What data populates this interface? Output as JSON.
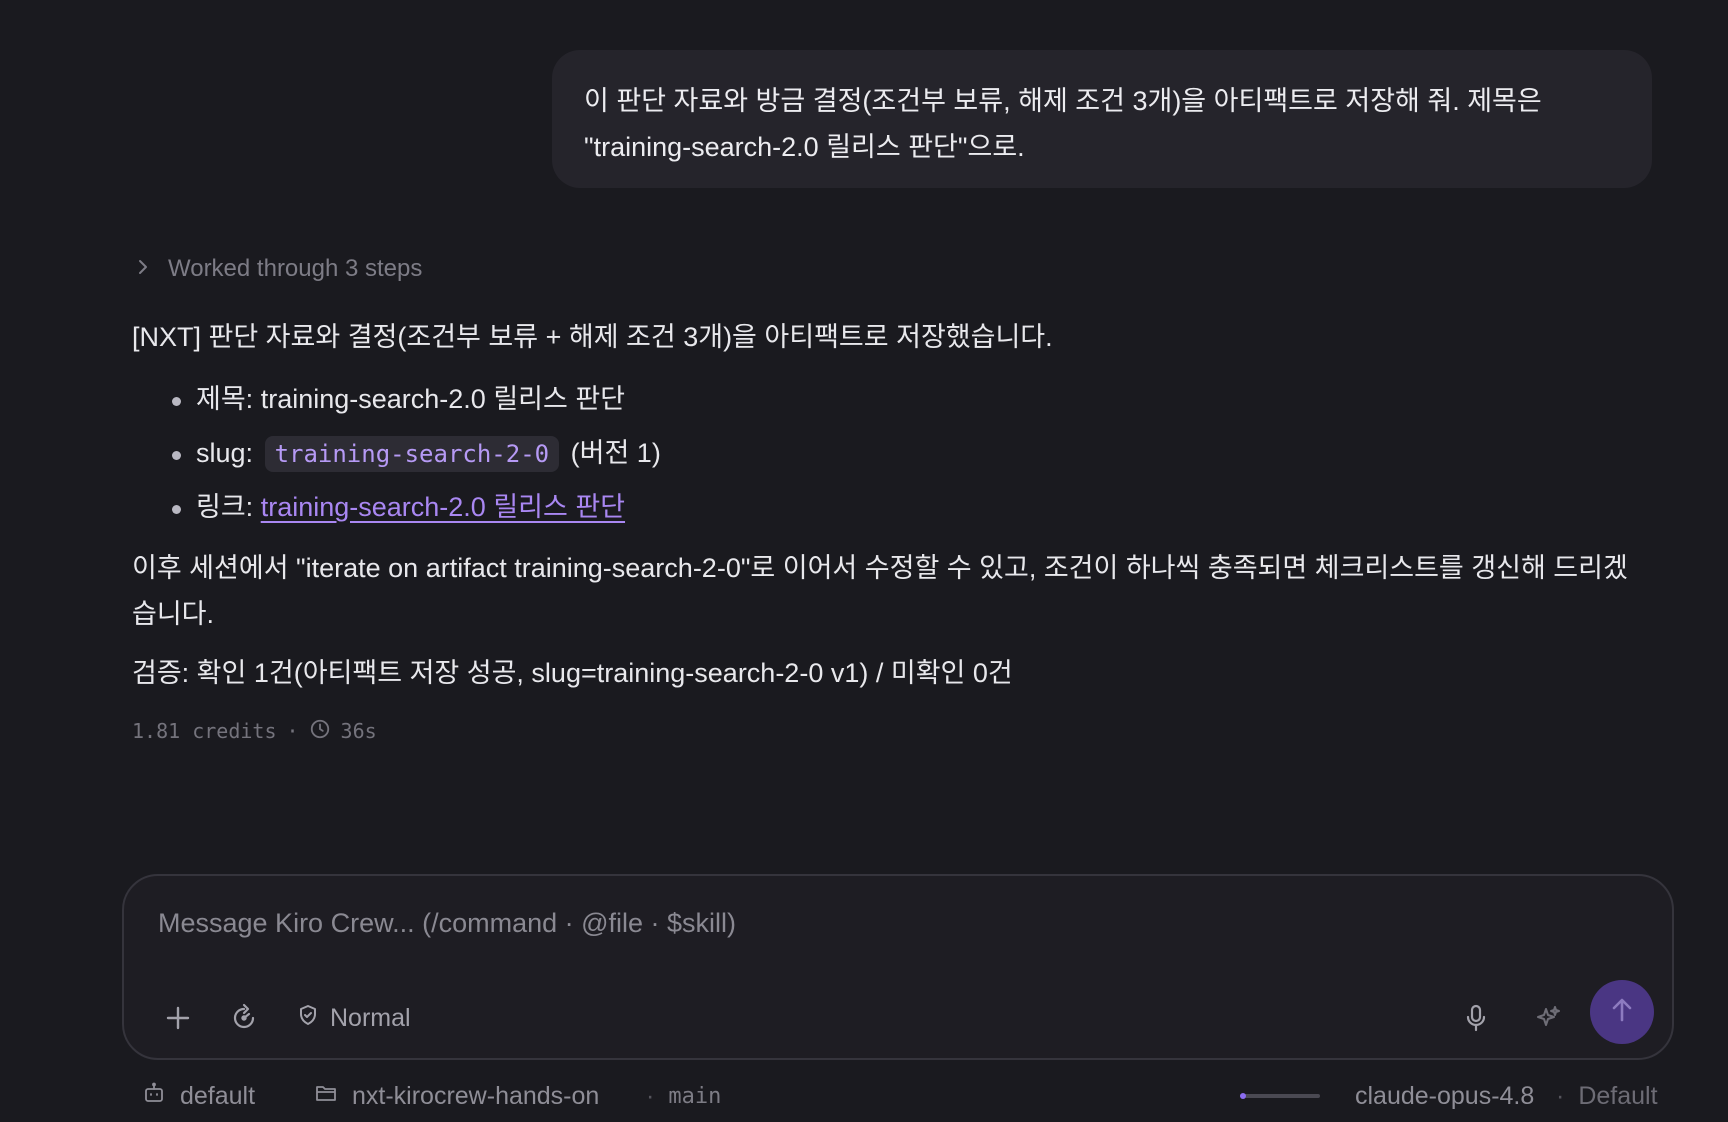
{
  "user_message": {
    "line1": "이 판단 자료와 방금 결정(조건부 보류, 해제 조건 3개)을 아티팩트로 저장해 줘. 제목은",
    "line2": "\"training-search-2.0 릴리스 판단\"으로."
  },
  "steps_toggle": {
    "label": "Worked through 3 steps",
    "icon": "chevron-right-icon"
  },
  "assistant": {
    "intro": "[NXT] 판단 자료와 결정(조건부 보류 + 해제 조건 3개)을 아티팩트로 저장했습니다.",
    "bullets": {
      "title_label": "제목:",
      "title_value": "training-search-2.0 릴리스 판단",
      "slug_label": "slug:",
      "slug_code": "training-search-2-0",
      "slug_version": "(버전 1)",
      "link_label": "링크:",
      "link_text": "training-search-2.0 릴리스 판단"
    },
    "followup": "이후 세션에서 \"iterate on artifact training-search-2-0\"로 이어서 수정할 수 있고, 조건이 하나씩 충족되면 체크리스트를 갱신해 드리겠습니다.",
    "verification": "검증: 확인 1건(아티팩트 저장 성공, slug=training-search-2-0 v1) / 미확인 0건",
    "meta": {
      "credits": "1.81 credits",
      "separator": "·",
      "duration": "36s"
    }
  },
  "composer": {
    "placeholder": "Message Kiro Crew... (/command · @file · $skill)",
    "value": "",
    "mode_label": "Normal",
    "icons": [
      "plus-icon",
      "refresh-gauge-icon",
      "shield-icon",
      "microphone-icon",
      "sparkle-icon",
      "arrow-up-icon"
    ]
  },
  "status_bar": {
    "agent": "default",
    "folder": "nxt-kirocrew-hands-on",
    "separator": "·",
    "branch": "main",
    "context_usage_fraction": 0.05,
    "model": "claude-opus-4.8",
    "profile": "Default"
  },
  "colors": {
    "background": "#1a1a1f",
    "bubble": "#25242b",
    "accent": "#a987f2",
    "send_button": "#4a3683"
  }
}
